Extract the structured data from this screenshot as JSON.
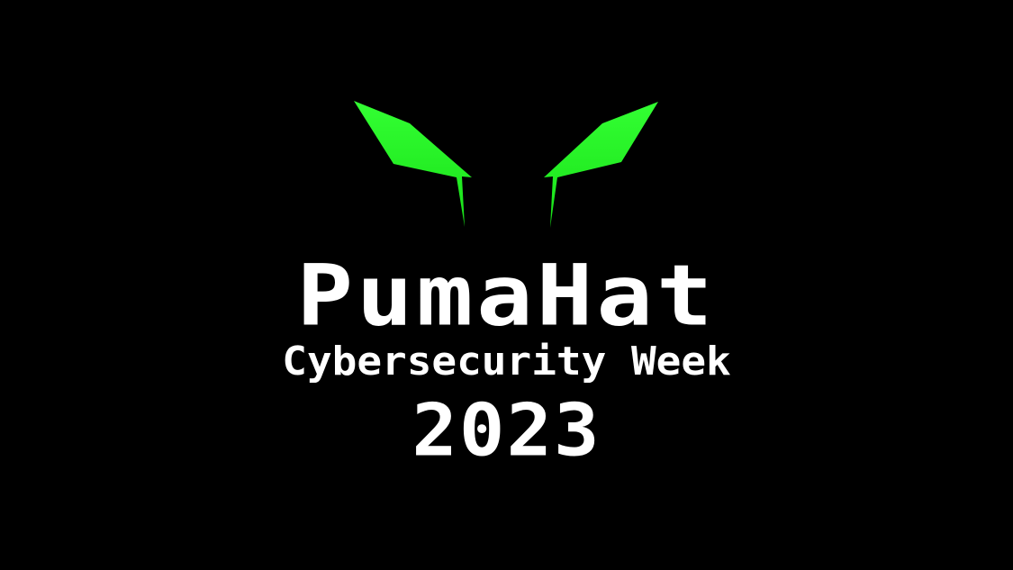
{
  "logo": {
    "brand": "PumaHat",
    "subtitle": "Cybersecurity Week",
    "year": "2023",
    "eye_color": "#22ff22",
    "text_color": "#ffffff",
    "background_color": "#000000",
    "icon": "puma-eyes-icon"
  }
}
